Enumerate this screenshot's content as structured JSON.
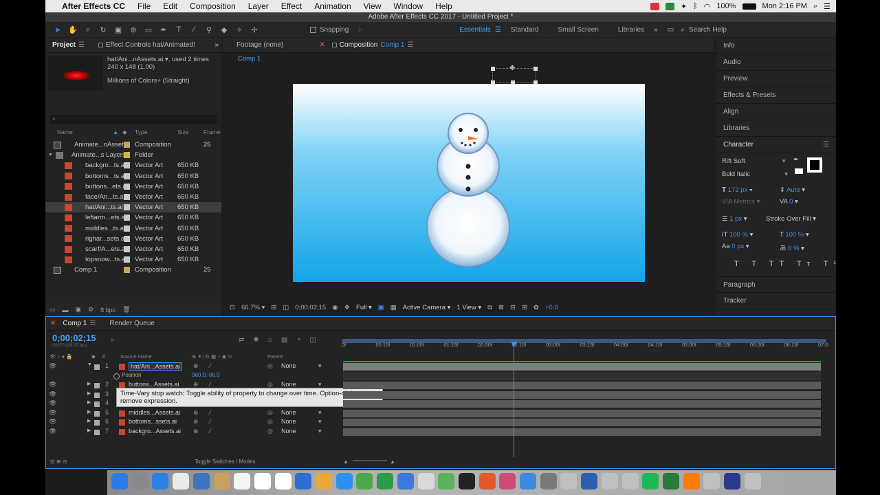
{
  "menubar": {
    "apple": "",
    "app_name": "After Effects CC",
    "items": [
      "File",
      "Edit",
      "Composition",
      "Layer",
      "Effect",
      "Animation",
      "View",
      "Window",
      "Help"
    ],
    "battery": "100%",
    "clock": "Mon 2:16 PM"
  },
  "window_title": "Adobe After Effects CC 2017 - Untitled Project *",
  "toolbar": {
    "snapping_label": "Snapping",
    "workspaces": [
      "Essentials",
      "Standard",
      "Small Screen",
      "Libraries"
    ],
    "active_workspace": "Essentials",
    "search_placeholder": "Search Help"
  },
  "project_panel": {
    "tab_project": "Project",
    "tab_effect_controls": "Effect Controls hat/Animated!",
    "preview_name": "hat/Ani...nAssets.ai",
    "preview_used": ", used 2 times",
    "preview_size": "240 x 148 (1.00)",
    "preview_color": "Millions of Colors+ (Straight)",
    "columns": {
      "name": "Name",
      "type": "Type",
      "size": "Size",
      "frame": "Frame"
    },
    "items": [
      {
        "name": "Animate...nAssets",
        "type": "Composition",
        "size": "",
        "frame": "25",
        "kind": "comp",
        "indent": 0,
        "color": "#c9a35a"
      },
      {
        "name": "Animate...s Layers",
        "type": "Folder",
        "size": "",
        "frame": "",
        "kind": "folder",
        "indent": 0,
        "color": "#d8b640"
      },
      {
        "name": "backgro...ts.ai",
        "type": "Vector Art",
        "size": "650 KB",
        "frame": "",
        "kind": "ai",
        "indent": 1,
        "color": "#c9c9c9"
      },
      {
        "name": "bottoms...ts.ai",
        "type": "Vector Art",
        "size": "650 KB",
        "frame": "",
        "kind": "ai",
        "indent": 1,
        "color": "#c9c9c9"
      },
      {
        "name": "buttons...ets.ai",
        "type": "Vector Art",
        "size": "650 KB",
        "frame": "",
        "kind": "ai",
        "indent": 1,
        "color": "#c9c9c9"
      },
      {
        "name": "face/An...ts.ai",
        "type": "Vector Art",
        "size": "650 KB",
        "frame": "",
        "kind": "ai",
        "indent": 1,
        "color": "#c9c9c9"
      },
      {
        "name": "hat/Ani...ts.ai",
        "type": "Vector Art",
        "size": "650 KB",
        "frame": "",
        "kind": "ai",
        "indent": 1,
        "color": "#c9c9c9",
        "selected": true
      },
      {
        "name": "leftarm...ets.ai",
        "type": "Vector Art",
        "size": "650 KB",
        "frame": "",
        "kind": "ai",
        "indent": 1,
        "color": "#c9c9c9"
      },
      {
        "name": "middles...ts.ai",
        "type": "Vector Art",
        "size": "650 KB",
        "frame": "",
        "kind": "ai",
        "indent": 1,
        "color": "#c9c9c9"
      },
      {
        "name": "righar...sets.ai",
        "type": "Vector Art",
        "size": "650 KB",
        "frame": "",
        "kind": "ai",
        "indent": 1,
        "color": "#c9c9c9"
      },
      {
        "name": "scarf/A...ets.ai",
        "type": "Vector Art",
        "size": "650 KB",
        "frame": "",
        "kind": "ai",
        "indent": 1,
        "color": "#c9c9c9"
      },
      {
        "name": "topsnow...ts.ai",
        "type": "Vector Art",
        "size": "650 KB",
        "frame": "",
        "kind": "ai",
        "indent": 1,
        "color": "#c9c9c9"
      },
      {
        "name": "Comp 1",
        "type": "Composition",
        "size": "",
        "frame": "25",
        "kind": "comp",
        "indent": 0,
        "color": "#c9a35a"
      }
    ],
    "bpc": "8 bpc"
  },
  "viewer": {
    "tab_footage": "Footage (none)",
    "tab_composition": "Composition",
    "comp_name": "Comp 1",
    "breadcrumb": "Comp 1",
    "zoom": "66.7%",
    "timecode": "0;00;02;15",
    "resolution": "Full",
    "camera": "Active Camera",
    "views": "1 View",
    "exposure": "+0.0"
  },
  "right_panel": {
    "items": [
      "Info",
      "Audio",
      "Preview",
      "Effects & Presets",
      "Align",
      "Libraries"
    ],
    "character_title": "Character",
    "font_family": "Rift Soft",
    "font_style": "Bold Italic",
    "font_size": "172 px",
    "leading": "Auto",
    "kerning": "Metrics",
    "tracking": "0",
    "stroke_width": "1 px",
    "stroke_mode": "Stroke Over Fill",
    "vert_scale": "100 %",
    "horiz_scale": "100 %",
    "baseline": "0 px",
    "tsume": "0 %",
    "bottom_items": [
      "Paragraph",
      "Tracker"
    ]
  },
  "timeline": {
    "tab_comp": "Comp 1",
    "tab_render": "Render Queue",
    "timecode": "0;00;02;15",
    "timecode_sub": "00075 (29.97 fps)",
    "col_source": "Source Name",
    "col_parent": "Parent",
    "ruler": [
      "0f",
      "00:15f",
      "01:00f",
      "01:15f",
      "02:00f",
      "02:15f",
      "03:00f",
      "03:15f",
      "04:00f",
      "04:15f",
      "05:00f",
      "05:15f",
      "06:00f",
      "06:15f",
      "07:0"
    ],
    "layers": [
      {
        "num": "1",
        "name": "hat/Ani...Assets.ai",
        "parent": "None"
      },
      {
        "num": "2",
        "name": "buttons...Assets.ai",
        "parent": "None"
      },
      {
        "num": "3",
        "name": "",
        "parent": ""
      },
      {
        "num": "4",
        "name": "",
        "parent": ""
      },
      {
        "num": "5",
        "name": "middles...Assets.ai",
        "parent": "None"
      },
      {
        "num": "6",
        "name": "bottoms...ssets.ai",
        "parent": "None"
      },
      {
        "num": "7",
        "name": "backgro...Assets.ai",
        "parent": "None"
      }
    ],
    "property_name": "Position",
    "property_value": "960.0,-86.0",
    "tooltip": "Time-Vary stop watch: Toggle ability of property to change over time. Option-click: add or remove expression.",
    "toggle_label": "Toggle Switches / Modes",
    "playhead_position_sec": 2.5,
    "duration_sec": 7
  },
  "colors": {
    "accent": "#3d8df5",
    "panel": "#232323",
    "layer_bar": "#5a5a5a"
  }
}
